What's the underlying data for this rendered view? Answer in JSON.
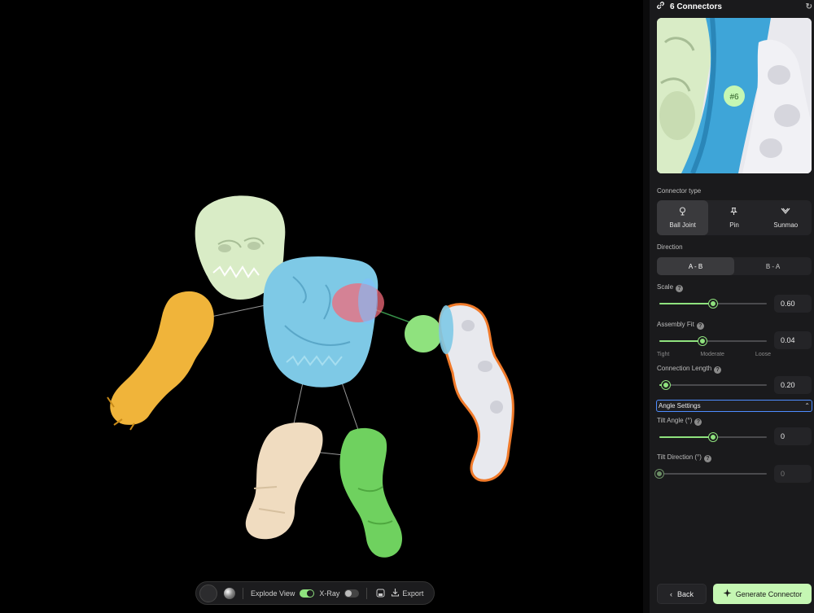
{
  "toolbar": {
    "explode_label": "Explode View",
    "explode_on": true,
    "xray_label": "X-Ray",
    "xray_on": false,
    "export_label": "Export",
    "icons": [
      "color-swatch-icon",
      "material-sphere-icon",
      "screenshot-icon",
      "download-icon"
    ]
  },
  "scene": {
    "selected_connector_badge": "#6",
    "part_colors": {
      "head": "#d9ecc6",
      "torso": "#7ec9e6",
      "left_arm": "#f0b43a",
      "right_arm": "#e8e9ee",
      "left_leg": "#f0dcc0",
      "right_leg": "#6fd15f",
      "connector_ball": "#8fe27e",
      "connector_socket": "#f26a7a",
      "selection_outline": "#f07a2a"
    }
  },
  "panel": {
    "header_title": "6 Connectors",
    "header_icon": "link-icon",
    "refresh_icon": "refresh-icon",
    "preview_badge": "#6",
    "connector_type_label": "Connector type",
    "connector_types": [
      {
        "label": "Ball Joint",
        "icon": "ball-joint-icon",
        "active": true
      },
      {
        "label": "Pin",
        "icon": "pin-icon",
        "active": false
      },
      {
        "label": "Sunmao",
        "icon": "sunmao-icon",
        "active": false
      }
    ],
    "direction_label": "Direction",
    "direction_options": [
      {
        "label": "A - B",
        "active": true
      },
      {
        "label": "B - A",
        "active": false
      }
    ],
    "scale": {
      "label": "Scale",
      "value": "0.60",
      "fraction": 0.5
    },
    "assembly_fit": {
      "label": "Assembly Fit",
      "value": "0.04",
      "fraction": 0.4,
      "ticks": [
        "Tight",
        "Moderate",
        "Loose"
      ]
    },
    "connection_length": {
      "label": "Connection Length",
      "value": "0.20",
      "fraction": 0.06
    },
    "angle_settings_label": "Angle Settings",
    "tilt_angle": {
      "label": "Tilt Angle (°)",
      "value": "0",
      "fraction": 0.5
    },
    "tilt_direction": {
      "label": "Tilt Direction (°)",
      "value": "0",
      "fraction": 0.0
    },
    "back_label": "Back",
    "generate_label": "Generate Connector"
  }
}
